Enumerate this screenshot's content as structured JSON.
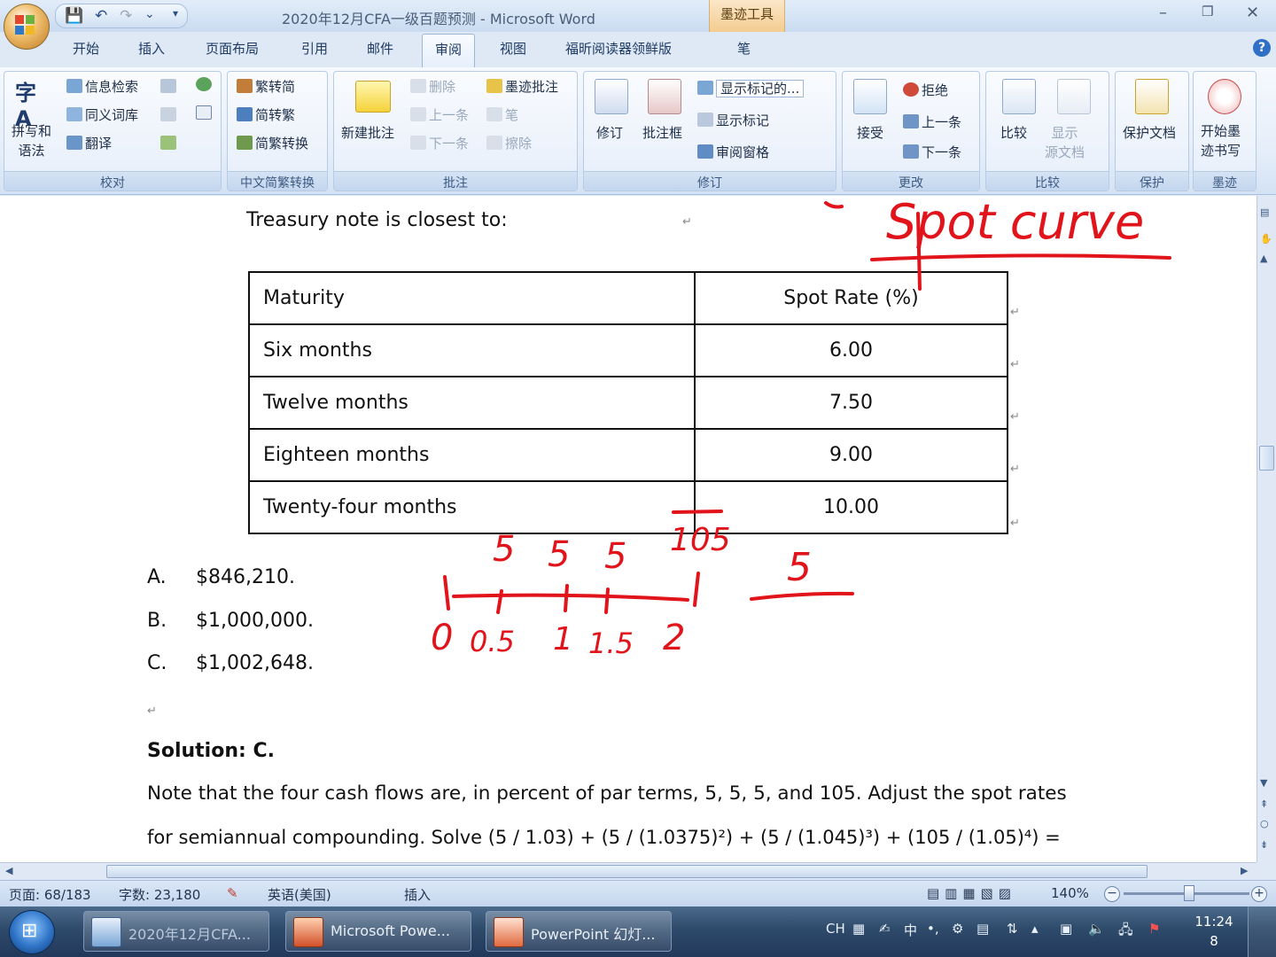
{
  "window": {
    "title": "2020年12月CFA一级百题预测 - Microsoft Word",
    "contextual_tab": "墨迹工具",
    "controls": [
      "–",
      "❐",
      "✕"
    ]
  },
  "quick_access": {
    "save": "💾",
    "undo": "↶",
    "redo": "↷",
    "more": "▾"
  },
  "tabs": [
    "开始",
    "插入",
    "页面布局",
    "引用",
    "邮件",
    "审阅",
    "视图",
    "福昕阅读器领鲜版",
    "笔"
  ],
  "active_tab": "审阅",
  "ribbon": {
    "proofing": {
      "label": "校对",
      "spelling": "拼写和\n语法",
      "research": "信息检索",
      "thesaurus": "同义词库",
      "translate": "翻译"
    },
    "chinese": {
      "label": "中文简繁转换",
      "to_simplified": "繁转简",
      "to_traditional": "简转繁",
      "convert": "简繁转换"
    },
    "comments": {
      "label": "批注",
      "new": "新建批注",
      "delete": "删除",
      "previous": "上一条",
      "next": "下一条",
      "ink_comment": "墨迹批注",
      "pen": "笔",
      "eraser": "擦除"
    },
    "tracking": {
      "label": "修订",
      "track": "修订",
      "balloons": "批注框",
      "display_for_review": "显示标记的...",
      "show_markup": "显示标记",
      "reviewing_pane": "审阅窗格"
    },
    "changes": {
      "label": "更改",
      "accept": "接受",
      "reject": "拒绝",
      "previous": "上一条",
      "next": "下一条"
    },
    "compare": {
      "label": "比较",
      "compare": "比较",
      "show_source": "显示\n源文档"
    },
    "protect": {
      "label": "保护",
      "protect": "保护文档"
    },
    "ink": {
      "label": "墨迹",
      "start_inking": "开始墨\n迹书写"
    }
  },
  "document": {
    "question_tail": "Treasury note is closest to:",
    "table": {
      "headers": [
        "Maturity",
        "Spot Rate (%)"
      ],
      "rows": [
        [
          "Six months",
          "6.00"
        ],
        [
          "Twelve months",
          "7.50"
        ],
        [
          "Eighteen months",
          "9.00"
        ],
        [
          "Twenty-four months",
          "10.00"
        ]
      ]
    },
    "options": [
      {
        "letter": "A.",
        "text": "$846,210."
      },
      {
        "letter": "B.",
        "text": "$1,000,000."
      },
      {
        "letter": "C.",
        "text": "$1,002,648."
      }
    ],
    "solution_label": "Solution: C.",
    "solution_line1": "Note that the four cash flows are, in percent of par terms, 5, 5, 5, and 105. Adjust the spot rates",
    "solution_line2": "for semiannual compounding. Solve (5 / 1.03) + (5 / (1.0375)²) + (5 / (1.045)³) + (105 / (1.05)⁴) ="
  },
  "ink_annotations": {
    "heading": "Spot curve",
    "cashflows": [
      "5",
      "5",
      "5",
      "105"
    ],
    "timeline": [
      "0",
      "0.5",
      "1",
      "1.5",
      "2"
    ],
    "side_note": "5"
  },
  "statusbar": {
    "page": "页面: 68/183",
    "words": "字数: 23,180",
    "language": "英语(美国)",
    "mode": "插入",
    "zoom": "140%"
  },
  "taskbar": {
    "items": [
      "2020年12月CFA...",
      "Microsoft Powe...",
      "PowerPoint 幻灯..."
    ],
    "ime": "CH",
    "ime_mode": "中",
    "time": "11:24",
    "date": "8"
  },
  "colors": {
    "ink_red": "#e0141a",
    "ribbon_bg": "#e4edf9",
    "taskbar": "#2e4a6a"
  }
}
